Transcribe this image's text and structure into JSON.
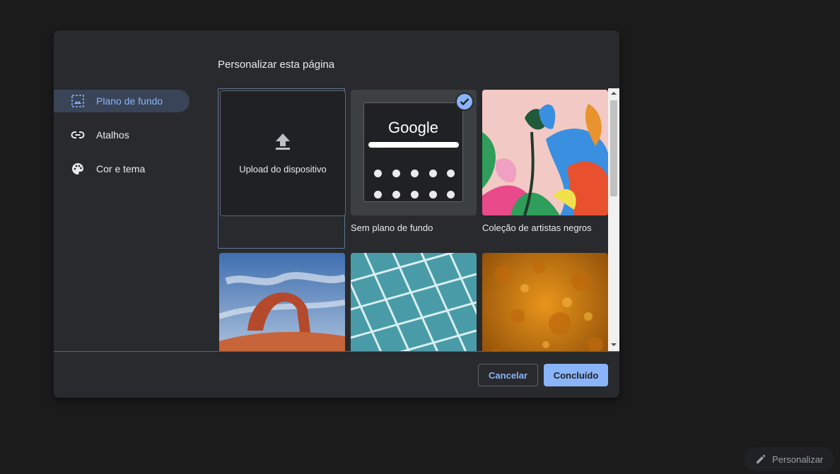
{
  "dialog": {
    "title": "Personalizar esta página",
    "nav": [
      {
        "label": "Plano de fundo",
        "icon": "wallpaper-icon",
        "selected": true
      },
      {
        "label": "Atalhos",
        "icon": "link-icon",
        "selected": false
      },
      {
        "label": "Cor e tema",
        "icon": "palette-icon",
        "selected": false
      }
    ],
    "tiles": {
      "upload_label": "Upload do dispositivo",
      "no_background_label": "Sem plano de fundo",
      "no_background_preview_word": "Google",
      "artists_label": "Coleção de artistas negros"
    },
    "buttons": {
      "cancel": "Cancelar",
      "done": "Concluído"
    }
  },
  "page": {
    "customize_button": "Personalizar"
  },
  "colors": {
    "accent": "#8ab4f8",
    "dialog_bg": "#292a2d",
    "page_bg": "#1b1b1c"
  }
}
